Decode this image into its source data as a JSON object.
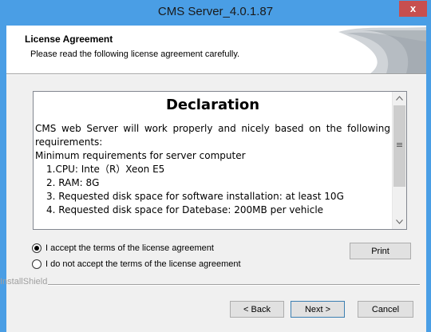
{
  "window": {
    "title": "CMS Server_4.0.1.87",
    "close_glyph": "x"
  },
  "header": {
    "title": "License Agreement",
    "subtitle": "Please read the following license agreement carefully."
  },
  "license_text": {
    "heading": "Declaration",
    "intro": "CMS web Server will work properly and nicely based on the following requirements:",
    "minimum": "Minimum requirements for server computer",
    "items": [
      "1.CPU: Inte（R）Xeon E5",
      "2. RAM: 8G",
      "3. Requested disk space for software installation: at least 10G",
      "4. Requested disk space for Datebase: 200MB per vehicle"
    ]
  },
  "scrollbar": {
    "up_icon": "chevron-up-icon",
    "down_icon": "chevron-down-icon",
    "grip_icon": "grip-icon"
  },
  "options": {
    "accept": "I accept the terms of the license agreement",
    "decline": "I do not accept the terms of the license agreement",
    "selected": "accept"
  },
  "buttons": {
    "print": "Print",
    "back": "< Back",
    "next": "Next >",
    "cancel": "Cancel"
  },
  "footer": {
    "brand": "InstallShield"
  },
  "colors": {
    "titlebar": "#4a9ee5",
    "close": "#c74f4f",
    "dialog_bg": "#f0f0f0"
  }
}
